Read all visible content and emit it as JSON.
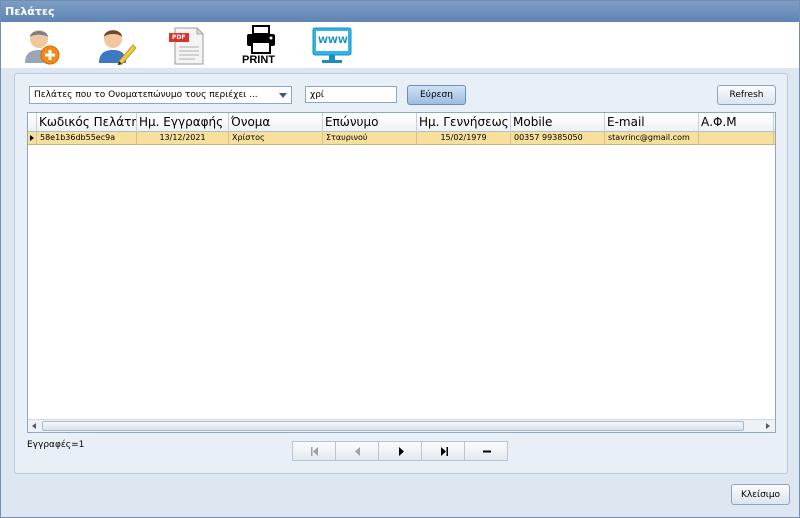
{
  "window": {
    "title": "Πελάτες"
  },
  "toolbar": [
    {
      "name": "add-customer-icon"
    },
    {
      "name": "edit-customer-icon"
    },
    {
      "name": "pdf-icon",
      "badge": "PDF"
    },
    {
      "name": "printer-icon",
      "label": "PRINT"
    },
    {
      "name": "web-icon",
      "label": "WWW"
    }
  ],
  "search": {
    "filter_selected": "Πελάτες που το Ονοματεπώνυμο τους περιέχει ...",
    "value": "χρί",
    "find_label": "Εύρεση",
    "refresh_label": "Refresh"
  },
  "grid": {
    "columns": [
      "Κωδικός Πελάτη",
      "Ημ. Εγγραφής",
      "Όνομα",
      "Επώνυμο",
      "Ημ. Γεννήσεως",
      "Mobile",
      "E-mail",
      "Α.Φ.Μ"
    ],
    "rows": [
      [
        "58e1b36db55ec9a",
        "13/12/2021",
        "Χρίστος",
        "Σταυρινού",
        "15/02/1979",
        "00357 99385050",
        "stavrinc@gmail.com",
        ""
      ]
    ]
  },
  "status": {
    "records": "Εγγραφές=1"
  },
  "navigation": [
    "first",
    "previous",
    "next",
    "last",
    "delete"
  ],
  "footer": {
    "close_label": "Κλείσιμο"
  },
  "colors": {
    "selected_row": "#f7df9c",
    "titlebar": "#6a8dbb",
    "find_button": "#b3cdea"
  }
}
